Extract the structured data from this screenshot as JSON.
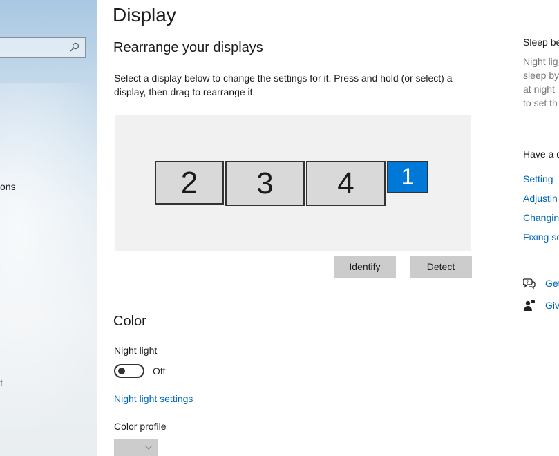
{
  "sidebar": {
    "search_placeholder": "",
    "visible_item_fragment_1": "ons",
    "visible_item_fragment_2": "t"
  },
  "main": {
    "title": "Display",
    "rearrange": {
      "heading": "Rearrange your displays",
      "description": "Select a display below to change the settings for it. Press and hold (or select) a display, then drag to rearrange it.",
      "monitors": [
        {
          "label": "2",
          "selected": false
        },
        {
          "label": "3",
          "selected": false
        },
        {
          "label": "4",
          "selected": false
        },
        {
          "label": "1",
          "selected": true
        }
      ],
      "identify_label": "Identify",
      "detect_label": "Detect",
      "accent_color": "#0078d7"
    },
    "color": {
      "heading": "Color",
      "night_light_label": "Night light",
      "night_light_state": "Off",
      "night_light_settings_link": "Night light settings",
      "color_profile_label": "Color profile",
      "color_profile_value": ""
    }
  },
  "right": {
    "sleep_heading": "Sleep be",
    "sleep_lines": [
      "Night lig",
      "sleep by",
      "at night",
      "to set th"
    ],
    "question_heading": "Have a q",
    "links": [
      "Setting",
      "Adjustin",
      "Changin",
      "Fixing sc"
    ],
    "get_help": "Get",
    "give_feedback": "Giv",
    "link_color": "#0067b8"
  }
}
